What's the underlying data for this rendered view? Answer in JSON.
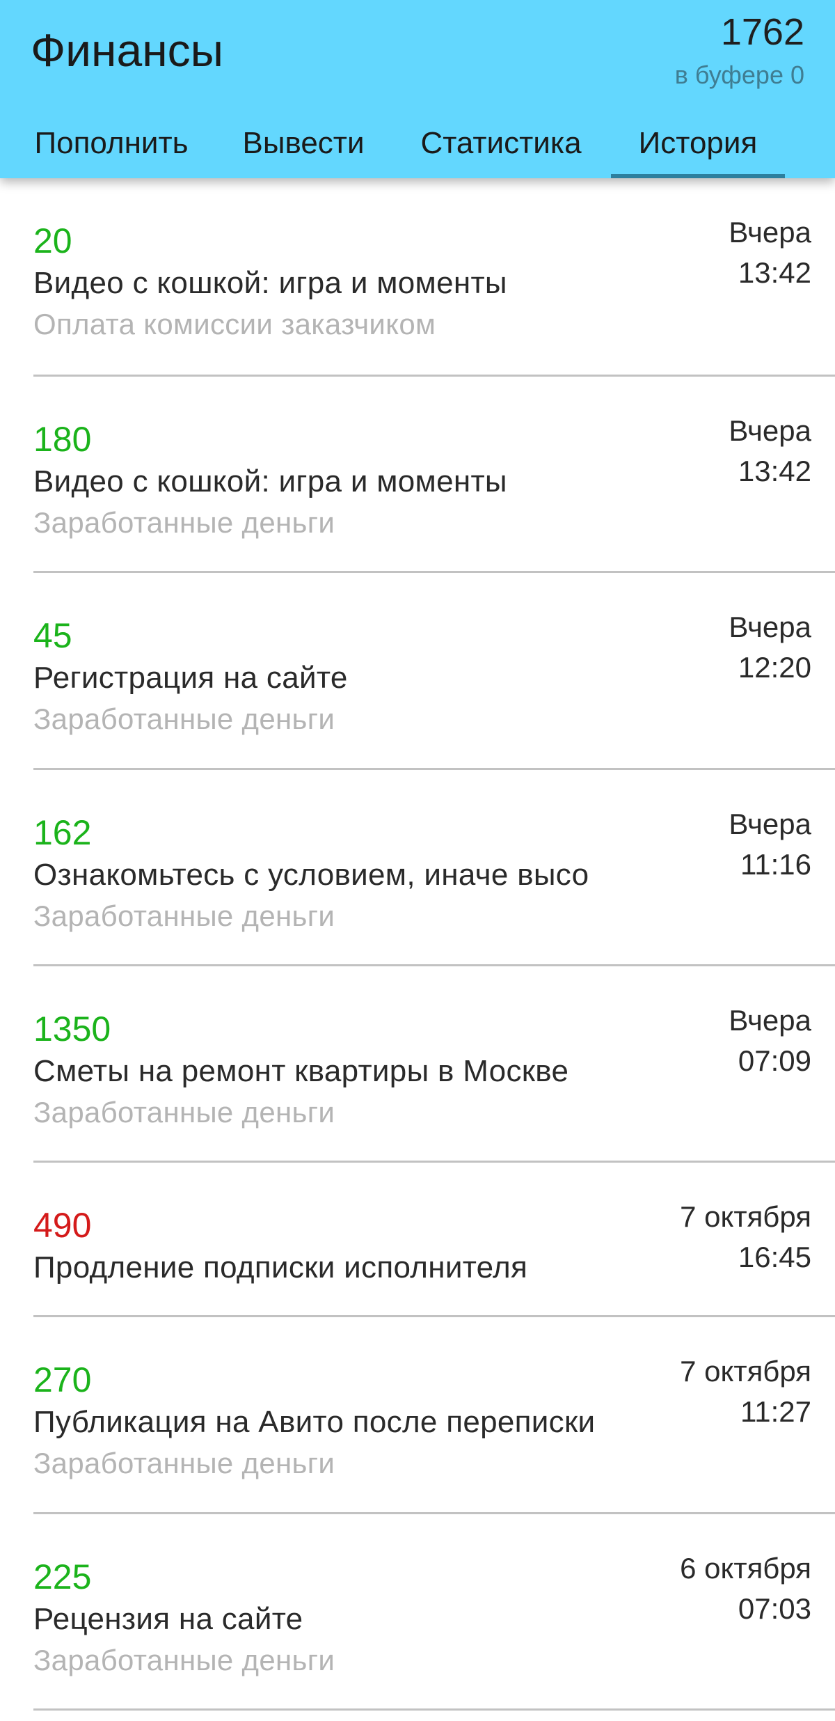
{
  "header": {
    "title": "Финансы",
    "balance": "1762",
    "buffer": "в буфере 0",
    "bg_color": "#63d7fe"
  },
  "tabs": [
    {
      "label": "Пополнить",
      "selected": false
    },
    {
      "label": "Вывести",
      "selected": false
    },
    {
      "label": "Статистика",
      "selected": false
    },
    {
      "label": "История",
      "selected": true
    }
  ],
  "colors": {
    "income": "#1bb31b",
    "expense": "#d41a1a",
    "subtitle": "#b4b4b4"
  },
  "history": [
    {
      "amount": "20",
      "kind": "income",
      "title": "Видео с кошкой: игра и моменты",
      "subtitle": "Оплата комиссии заказчиком",
      "date": "Вчера",
      "time": "13:42"
    },
    {
      "amount": "180",
      "kind": "income",
      "title": "Видео с кошкой: игра и моменты",
      "subtitle": "Заработанные деньги",
      "date": "Вчера",
      "time": "13:42"
    },
    {
      "amount": "45",
      "kind": "income",
      "title": "Регистрация на сайте",
      "subtitle": "Заработанные деньги",
      "date": "Вчера",
      "time": "12:20"
    },
    {
      "amount": "162",
      "kind": "income",
      "title": "Ознакомьтесь с условием, иначе высо",
      "subtitle": "Заработанные деньги",
      "date": "Вчера",
      "time": "11:16"
    },
    {
      "amount": "1350",
      "kind": "income",
      "title": "Сметы на ремонт квартиры в Москве",
      "subtitle": "Заработанные деньги",
      "date": "Вчера",
      "time": "07:09"
    },
    {
      "amount": "490",
      "kind": "expense",
      "title": "Продление подписки исполнителя",
      "subtitle": "",
      "date": "7 октября",
      "time": "16:45"
    },
    {
      "amount": "270",
      "kind": "income",
      "title": "Публикация на Авито после переписки",
      "subtitle": "Заработанные деньги",
      "date": "7 октября",
      "time": "11:27"
    },
    {
      "amount": "225",
      "kind": "income",
      "title": "Рецензия на сайте",
      "subtitle": "Заработанные деньги",
      "date": "6 октября",
      "time": "07:03"
    }
  ]
}
